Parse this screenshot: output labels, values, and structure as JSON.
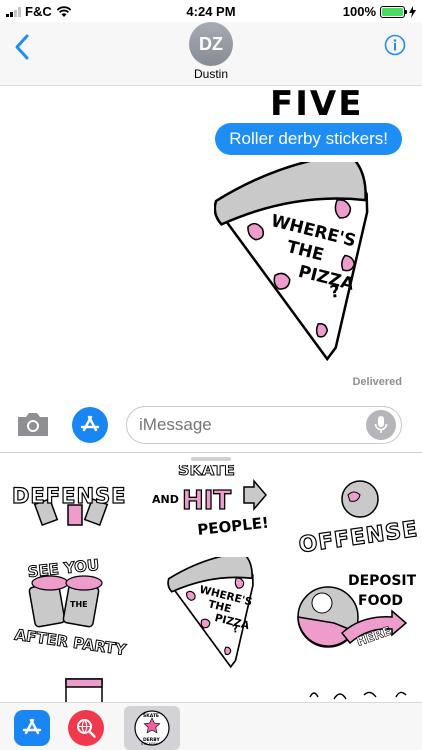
{
  "status_bar": {
    "carrier": "F&C",
    "time": "4:24 PM",
    "battery": "100%"
  },
  "header": {
    "contact_initials": "DZ",
    "contact_name": "Dustin"
  },
  "conversation": {
    "sticker_top_text": "FIVE",
    "message_text": "Roller derby stickers!",
    "pizza_sticker_text": [
      "WHERE'S",
      "THE",
      "PIZZA",
      "?"
    ],
    "delivery_status": "Delivered"
  },
  "composer": {
    "placeholder": "iMessage"
  },
  "sticker_drawer": {
    "stickers": [
      {
        "name": "defense",
        "text": "DEFENSE"
      },
      {
        "name": "skate-and-hit-people",
        "text": [
          "SKATE",
          "AND",
          "HIT",
          "PEOPLE!"
        ]
      },
      {
        "name": "offense",
        "text": "OFFENSE"
      },
      {
        "name": "see-you-after-party",
        "text": [
          "SEE YOU",
          "THE",
          "AFTER PARTY"
        ]
      },
      {
        "name": "wheres-the-pizza",
        "text": [
          "WHERE'S",
          "THE",
          "PIZZA",
          "?"
        ]
      },
      {
        "name": "deposit-food-here",
        "text": [
          "DEPOSIT",
          "FOOD",
          "HERE"
        ]
      }
    ]
  },
  "app_strip": {
    "active_app_label": [
      "SKATE",
      "DERBY",
      "STICKERS"
    ]
  },
  "colors": {
    "accent_blue": "#1e8df5",
    "sticker_pink": "#ee9ccb",
    "sticker_gray": "#c9c9c9",
    "battery_green": "#4cd964"
  }
}
